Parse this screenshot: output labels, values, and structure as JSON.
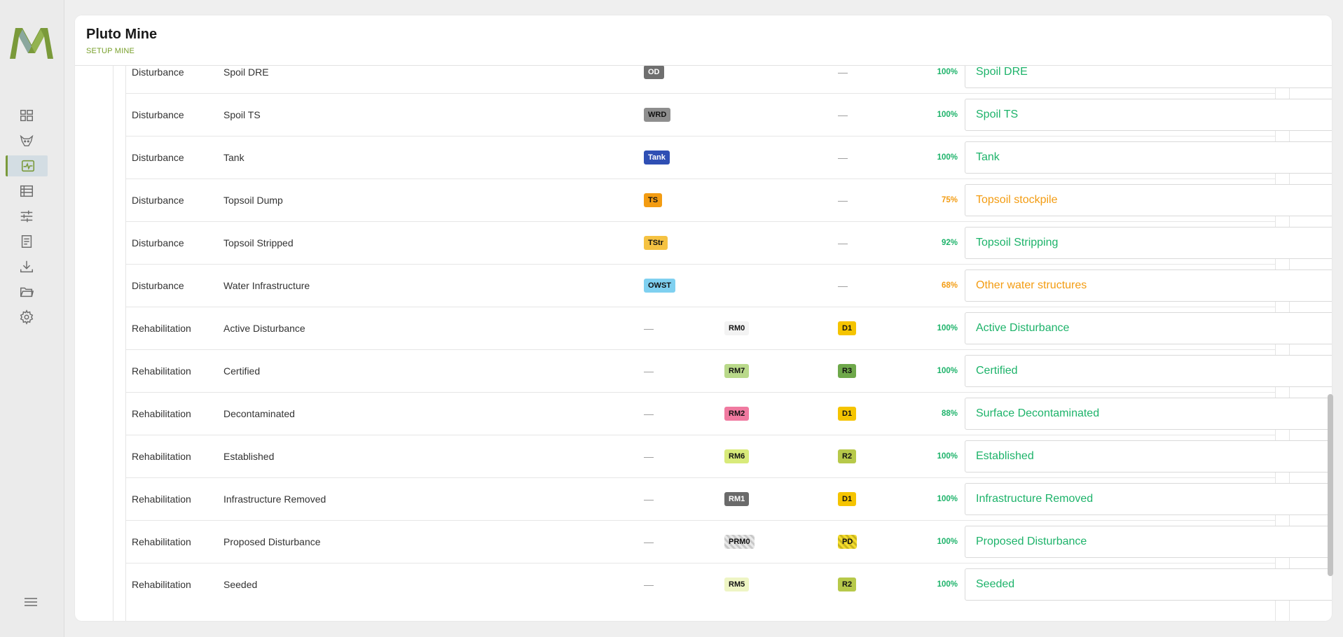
{
  "app": {
    "title": "Pluto Mine",
    "subtitle": "SETUP MINE"
  },
  "nav": [
    {
      "icon": "dashboard-icon",
      "active": false
    },
    {
      "icon": "animal-icon",
      "active": false
    },
    {
      "icon": "activity-icon",
      "active": true
    },
    {
      "icon": "list-icon",
      "active": false
    },
    {
      "icon": "sliders-icon",
      "active": false
    },
    {
      "icon": "document-icon",
      "active": false
    },
    {
      "icon": "download-icon",
      "active": false
    },
    {
      "icon": "folder-icon",
      "active": false
    },
    {
      "icon": "settings-icon",
      "active": false
    }
  ],
  "colors": {
    "accent": "#79a02c",
    "green_text": "#1db36a",
    "orange_text": "#f39c12"
  },
  "rows": [
    {
      "category": "Disturbance",
      "name": "Spoil DRE",
      "b1": "OD",
      "b2": "",
      "b3": "—",
      "pct": "100%",
      "select": "Spoil DRE",
      "status": "green"
    },
    {
      "category": "Disturbance",
      "name": "Spoil TS",
      "b1": "WRD",
      "b2": "",
      "b3": "—",
      "pct": "100%",
      "select": "Spoil TS",
      "status": "green"
    },
    {
      "category": "Disturbance",
      "name": "Tank",
      "b1": "Tank",
      "b2": "",
      "b3": "—",
      "pct": "100%",
      "select": "Tank",
      "status": "green"
    },
    {
      "category": "Disturbance",
      "name": "Topsoil Dump",
      "b1": "TS",
      "b2": "",
      "b3": "—",
      "pct": "75%",
      "select": "Topsoil stockpile",
      "status": "orange"
    },
    {
      "category": "Disturbance",
      "name": "Topsoil Stripped",
      "b1": "TStr",
      "b2": "",
      "b3": "—",
      "pct": "92%",
      "select": "Topsoil Stripping",
      "status": "green"
    },
    {
      "category": "Disturbance",
      "name": "Water Infrastructure",
      "b1": "OWST",
      "b2": "",
      "b3": "—",
      "pct": "68%",
      "select": "Other water structures",
      "status": "orange"
    },
    {
      "category": "Rehabilitation",
      "name": "Active Disturbance",
      "b1": "—",
      "b2": "RM0",
      "b3": "D1",
      "pct": "100%",
      "select": "Active Disturbance",
      "status": "green"
    },
    {
      "category": "Rehabilitation",
      "name": "Certified",
      "b1": "—",
      "b2": "RM7",
      "b3": "R3",
      "pct": "100%",
      "select": "Certified",
      "status": "green"
    },
    {
      "category": "Rehabilitation",
      "name": "Decontaminated",
      "b1": "—",
      "b2": "RM2",
      "b3": "D1",
      "pct": "88%",
      "select": "Surface Decontaminated",
      "status": "green"
    },
    {
      "category": "Rehabilitation",
      "name": "Established",
      "b1": "—",
      "b2": "RM6",
      "b3": "R2",
      "pct": "100%",
      "select": "Established",
      "status": "green"
    },
    {
      "category": "Rehabilitation",
      "name": "Infrastructure Removed",
      "b1": "—",
      "b2": "RM1",
      "b3": "D1",
      "pct": "100%",
      "select": "Infrastructure Removed",
      "status": "green"
    },
    {
      "category": "Rehabilitation",
      "name": "Proposed Disturbance",
      "b1": "—",
      "b2": "PRM0",
      "b3": "PD",
      "pct": "100%",
      "select": "Proposed Disturbance",
      "status": "green"
    },
    {
      "category": "Rehabilitation",
      "name": "Seeded",
      "b1": "—",
      "b2": "RM5",
      "b3": "R2",
      "pct": "100%",
      "select": "Seeded",
      "status": "green"
    }
  ]
}
